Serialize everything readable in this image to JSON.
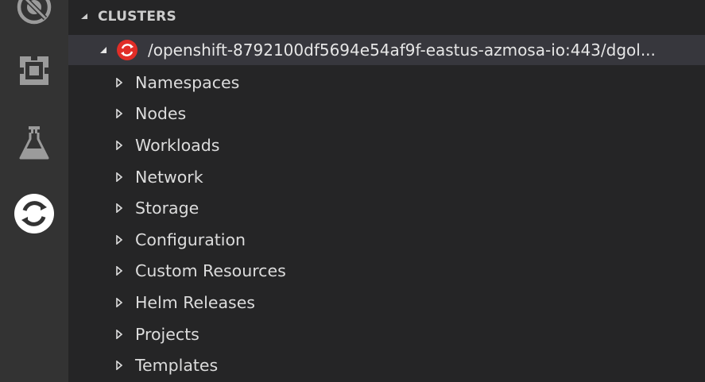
{
  "activity_bar": {
    "icons": [
      {
        "name": "debug-icon"
      },
      {
        "name": "extensions-icon"
      },
      {
        "name": "test-flask-icon"
      },
      {
        "name": "openshift-icon",
        "active": true
      }
    ]
  },
  "explorer": {
    "section_title": "CLUSTERS",
    "cluster": {
      "label": "/openshift-8792100df5694e54af9f-eastus-azmosa-io:443/dgol...",
      "expanded": true,
      "icon": "openshift-logo-icon"
    },
    "items": [
      {
        "label": "Namespaces"
      },
      {
        "label": "Nodes"
      },
      {
        "label": "Workloads"
      },
      {
        "label": "Network"
      },
      {
        "label": "Storage"
      },
      {
        "label": "Configuration"
      },
      {
        "label": "Custom Resources"
      },
      {
        "label": "Helm Releases"
      },
      {
        "label": "Projects"
      },
      {
        "label": "Templates"
      }
    ]
  },
  "colors": {
    "activity_bar_bg": "#333333",
    "sidebar_bg": "#252526",
    "selected_row_bg": "#37373d",
    "openshift_red": "#e12d27",
    "text": "#dcdcdc"
  }
}
